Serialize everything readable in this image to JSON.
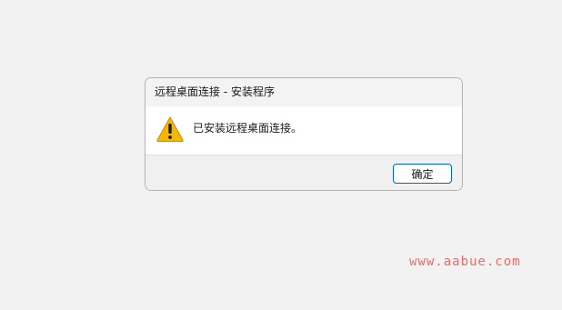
{
  "dialog": {
    "title": "远程桌面连接 - 安装程序",
    "message": "已安装远程桌面连接。",
    "icon": "warning-icon",
    "ok_label": "确定"
  },
  "watermark": {
    "text": "www.aabue.com",
    "color": "#ec6b6b"
  },
  "colors": {
    "background": "#f2f2f2",
    "dialog_content": "#ffffff",
    "button_border": "#0067c0",
    "warning_fill": "#f5b800"
  }
}
